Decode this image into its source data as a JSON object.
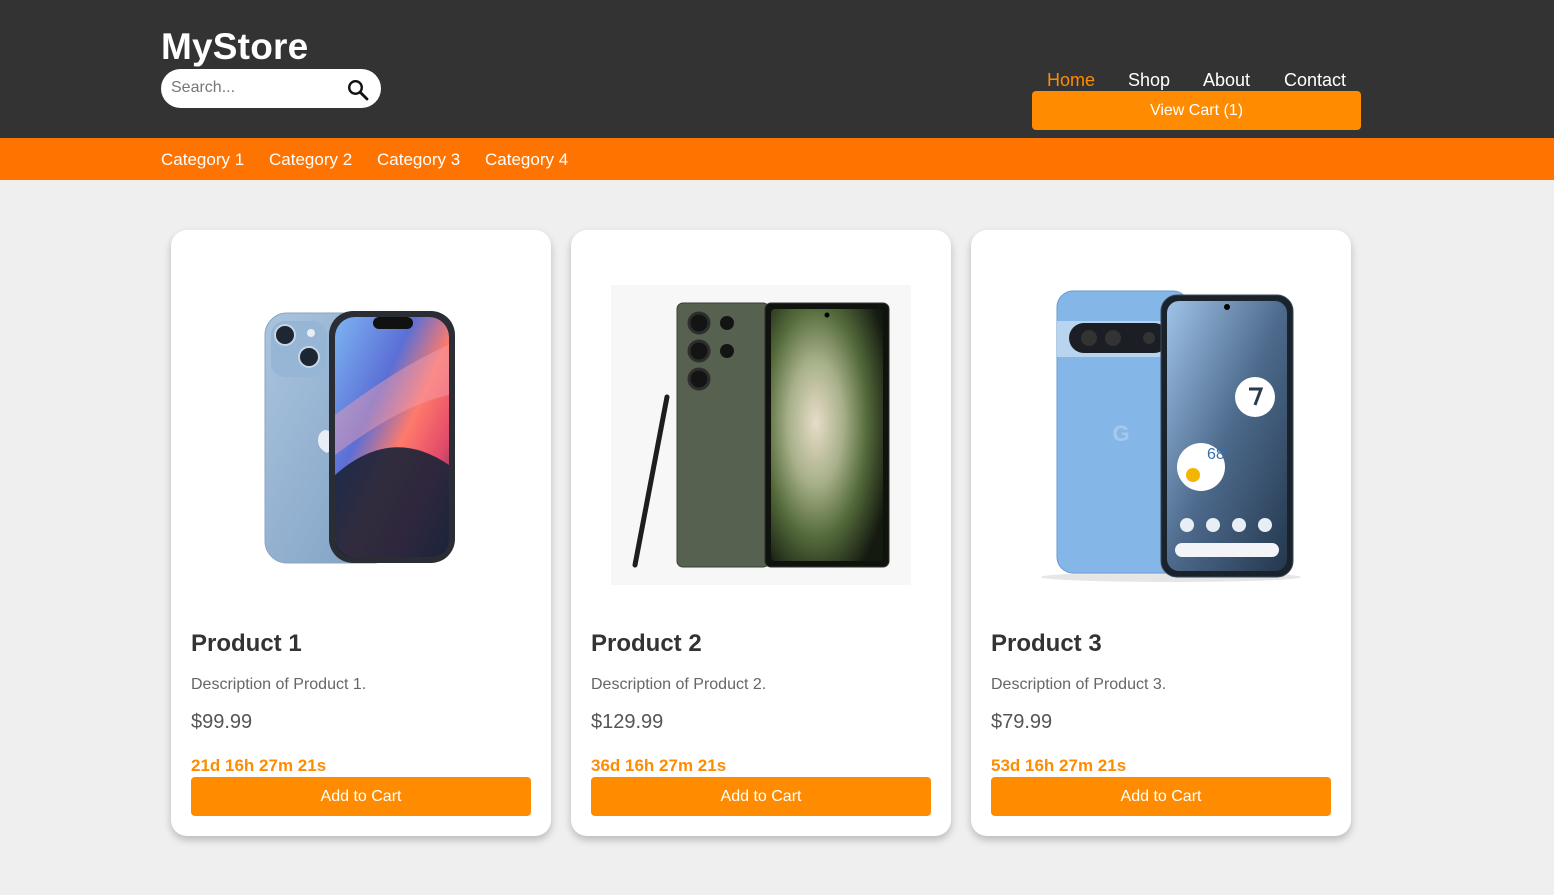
{
  "header": {
    "logo": "MyStore",
    "search": {
      "placeholder": "Search...",
      "value": "",
      "icon": "search-icon"
    },
    "nav": [
      {
        "label": "Home",
        "active": true
      },
      {
        "label": "Shop",
        "active": false
      },
      {
        "label": "About",
        "active": false
      },
      {
        "label": "Contact",
        "active": false
      }
    ],
    "cart_label": "View Cart (1)"
  },
  "categories": [
    "Category 1",
    "Category 2",
    "Category 3",
    "Category 4"
  ],
  "products": [
    {
      "title": "Product 1",
      "description": "Description of Product 1.",
      "price": "$99.99",
      "countdown": "21d 16h 27m 21s",
      "button": "Add to Cart",
      "image": "iphone-image"
    },
    {
      "title": "Product 2",
      "description": "Description of Product 2.",
      "price": "$129.99",
      "countdown": "36d 16h 27m 21s",
      "button": "Add to Cart",
      "image": "galaxy-image"
    },
    {
      "title": "Product 3",
      "description": "Description of Product 3.",
      "price": "$79.99",
      "countdown": "53d 16h 27m 21s",
      "button": "Add to Cart",
      "image": "pixel-image"
    }
  ],
  "colors": {
    "header_bg": "#333333",
    "accent": "#ff8c00",
    "category_bar": "#ff7300",
    "page_bg": "#efefef"
  }
}
